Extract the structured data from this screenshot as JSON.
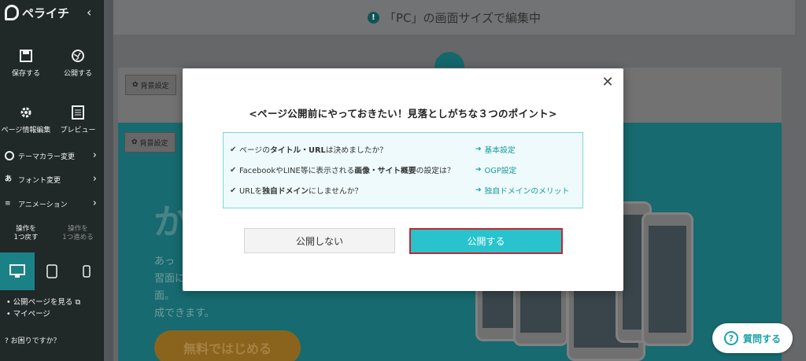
{
  "app": {
    "logo_text": "ペライチ"
  },
  "sidebar": {
    "save_label": "保存する",
    "publish_label": "公開する",
    "page_info_label": "ページ情報編集",
    "preview_label": "プレビュー",
    "theme_color_label": "テーマカラー変更",
    "font_label": "フォント変更",
    "animation_label": "アニメーション",
    "undo_label": "操作を\n1つ戻す",
    "redo_label": "操作を\n1つ進める",
    "links": [
      "公開ページを見る",
      "マイページ"
    ],
    "help_label": "お困りですか？"
  },
  "topbar": {
    "notice": "「PC」の画面サイズで編集中"
  },
  "canvas": {
    "section_setting_label": "背景設定",
    "hero_title": "か",
    "hero_copy_lines": [
      "あっ",
      "習面に",
      "面。",
      "成できます。"
    ],
    "cta_label": "無料ではじめる"
  },
  "modal": {
    "title": "<ページ公開前にやっておきたい！見落としがちな３つのポイント>",
    "items": [
      {
        "q_pre": "ページの",
        "q_bold": "タイトル・URL",
        "q_post": "は決めましたか？",
        "link": "基本設定"
      },
      {
        "q_pre": "FacebookやLINE等に表示される",
        "q_bold": "画像・サイト概要",
        "q_post": "の設定は？",
        "link": "OGP設定"
      },
      {
        "q_pre": "URLを",
        "q_bold": "独自ドメイン",
        "q_post": "にしませんか？",
        "link": "独自ドメインのメリット"
      }
    ],
    "cancel_label": "公開しない",
    "confirm_label": "公開する"
  },
  "help_button": {
    "label": "質問する"
  },
  "colors": {
    "accent": "#28c3cd",
    "link": "#1a9aa3",
    "highlight_border": "#c8232c",
    "sidebar_bg": "#232b2b"
  }
}
